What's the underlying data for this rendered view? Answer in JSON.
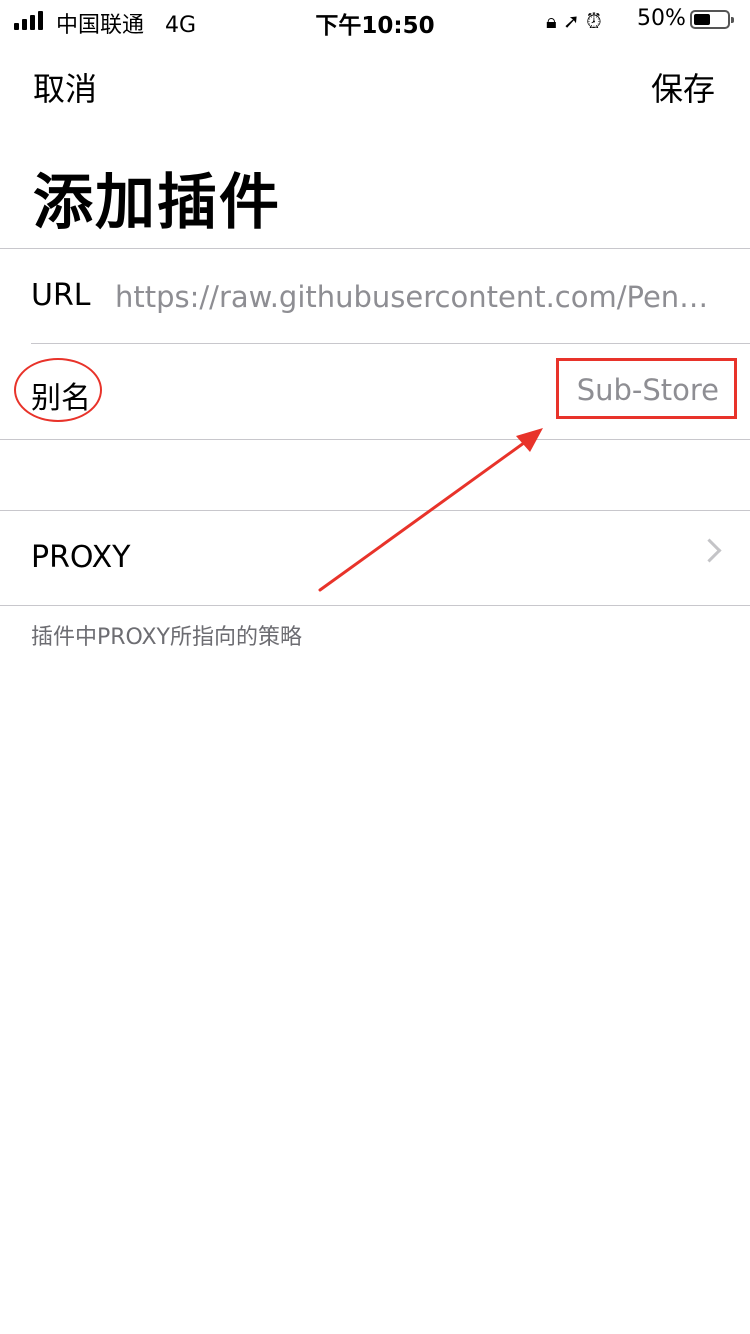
{
  "status_bar": {
    "carrier": "中国联通",
    "network": "4G",
    "time": "下午10:50",
    "battery_percent": "50%",
    "battery_level": 0.5
  },
  "nav": {
    "cancel_label": "取消",
    "save_label": "保存",
    "title": "添加插件"
  },
  "form": {
    "url": {
      "label": "URL",
      "value": "https://raw.githubusercontent.com/Peng-Y..."
    },
    "alias": {
      "label": "别名",
      "value": "Sub-Store"
    },
    "proxy": {
      "label": "PROXY",
      "footnote": "插件中PROXY所指向的策略"
    }
  },
  "icons": [
    "signal-icon",
    "rotation-lock-icon",
    "location-icon",
    "alarm-icon",
    "battery-icon",
    "chevron-right-icon"
  ],
  "annotation_color": "#e8332a"
}
